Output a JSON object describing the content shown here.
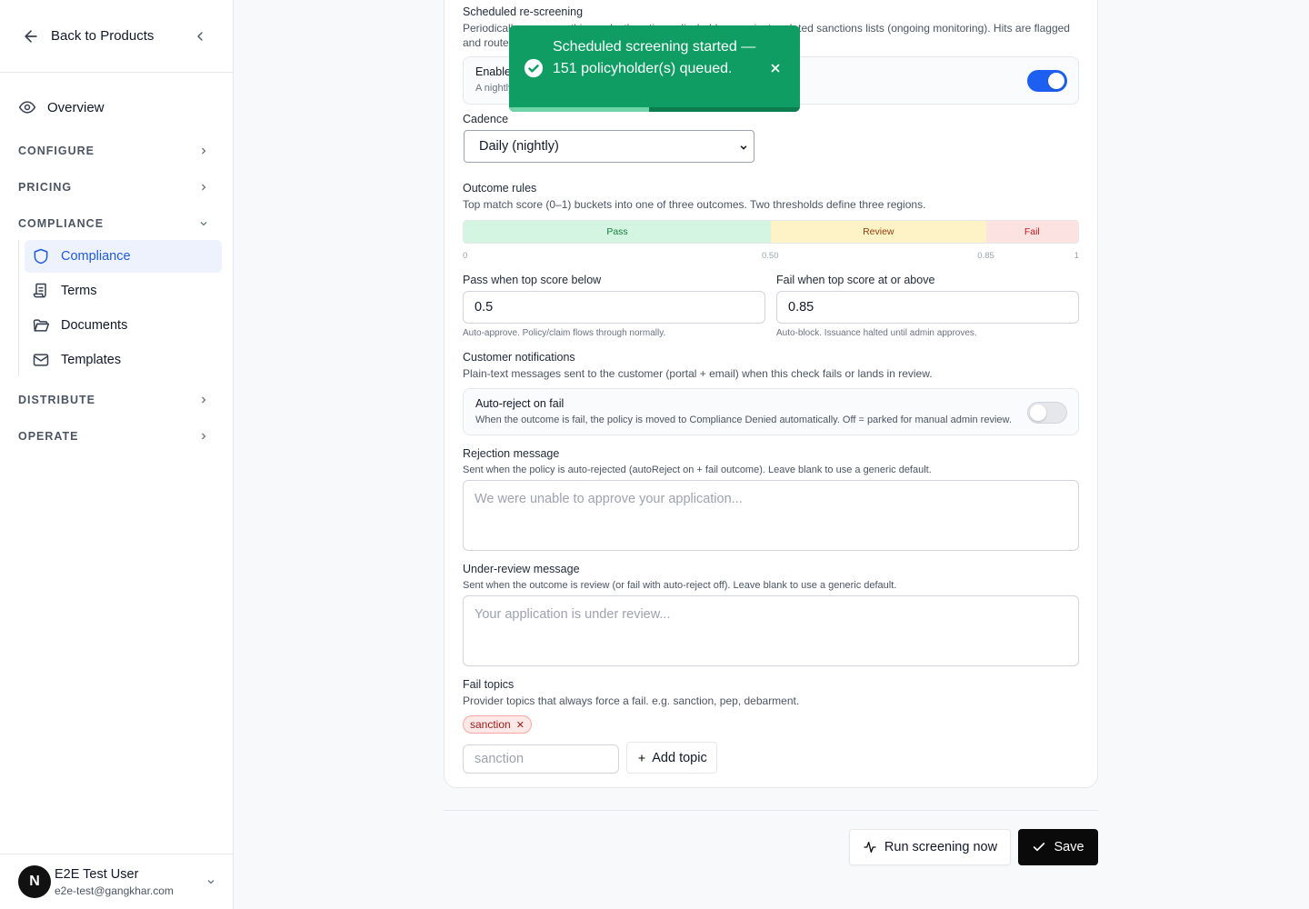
{
  "sidebar": {
    "back_label": "Back to Products",
    "overview_label": "Overview",
    "groups": {
      "configure": "CONFIGURE",
      "pricing": "PRICING",
      "compliance": "COMPLIANCE",
      "distribute": "DISTRIBUTE",
      "operate": "OPERATE"
    },
    "compliance_items": [
      "Compliance",
      "Terms",
      "Documents",
      "Templates"
    ],
    "user": {
      "initial": "N",
      "name": "E2E Test User",
      "email": "e2e-test@gangkhar.com"
    }
  },
  "toast": {
    "message": "Scheduled screening started — 151 policyholder(s) queued.",
    "progress": 0.48
  },
  "rescreening": {
    "title": "Scheduled re-screening",
    "description": "Periodically re-screen this product's active policyholders against updated sanctions lists (ongoing monitoring). Hits are flagged and routed",
    "enable_label": "Enable",
    "enable_desc": "A nightly",
    "enabled": true
  },
  "cadence": {
    "label": "Cadence",
    "value": "Daily (nightly)"
  },
  "outcome": {
    "title": "Outcome rules",
    "description": "Top match score (0–1) buckets into one of three outcomes. Two thresholds define three regions.",
    "segments": [
      {
        "label": "Pass",
        "start": 0,
        "end": 0.5,
        "bg": "#d5f5e3",
        "fg": "#15803d"
      },
      {
        "label": "Review",
        "start": 0.5,
        "end": 0.85,
        "bg": "#fdf3c7",
        "fg": "#92400e"
      },
      {
        "label": "Fail",
        "start": 0.85,
        "end": 1,
        "bg": "#fde2e2",
        "fg": "#b91c1c"
      }
    ],
    "ticks": [
      {
        "label": "0",
        "value": 0
      },
      {
        "label": "0.50",
        "value": 0.5
      },
      {
        "label": "0.85",
        "value": 0.85
      },
      {
        "label": "1",
        "value": 1
      }
    ],
    "pass_label": "Pass when top score below",
    "pass_value": "0.5",
    "pass_help": "Auto-approve. Policy/claim flows through normally.",
    "fail_label": "Fail when top score at or above",
    "fail_value": "0.85",
    "fail_help": "Auto-block. Issuance halted until admin approves."
  },
  "notifications": {
    "title": "Customer notifications",
    "description": "Plain-text messages sent to the customer (portal + email) when this check fails or lands in review.",
    "autoreject_label": "Auto-reject on fail",
    "autoreject_desc": "When the outcome is fail, the policy is moved to Compliance Denied automatically. Off = parked for manual admin review.",
    "autoreject": false,
    "rejection_label": "Rejection message",
    "rejection_desc": "Sent when the policy is auto-rejected (autoReject on + fail outcome). Leave blank to use a generic default.",
    "rejection_placeholder": "We were unable to approve your application...",
    "review_label": "Under-review message",
    "review_desc": "Sent when the outcome is review (or fail with auto-reject off). Leave blank to use a generic default.",
    "review_placeholder": "Your application is under review..."
  },
  "fail_topics": {
    "title": "Fail topics",
    "description": "Provider topics that always force a fail. e.g. sanction, pep, debarment.",
    "tags": [
      "sanction"
    ],
    "input_placeholder": "sanction",
    "add_label": "Add topic"
  },
  "actions": {
    "run_label": "Run screening now",
    "save_label": "Save"
  }
}
